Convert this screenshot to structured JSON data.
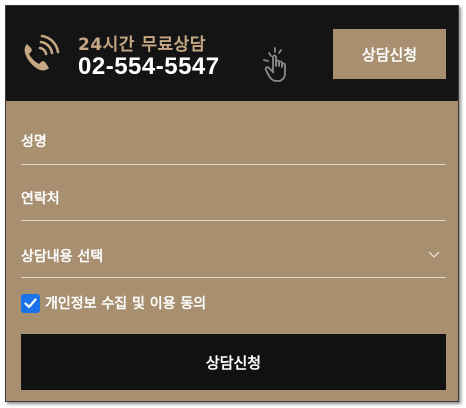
{
  "header": {
    "hours_label": "24시간 무료상담",
    "phone_number": "02-554-5547",
    "consult_button": "상담신청",
    "phone_icon": "phone-ringing-icon",
    "tap_icon": "hand-tap-icon"
  },
  "form": {
    "name_placeholder": "성명",
    "phone_placeholder": "연락처",
    "select_label": "상담내용 선택",
    "agree_label": "개인정보 수집 및 이용 동의",
    "agree_checked": true,
    "submit_label": "상담신청"
  },
  "colors": {
    "header_bg": "#141414",
    "brand_tan": "#a88f70",
    "gold_text": "#c5a883",
    "checkbox_blue": "#1a73e8",
    "submit_bg": "#111111"
  }
}
